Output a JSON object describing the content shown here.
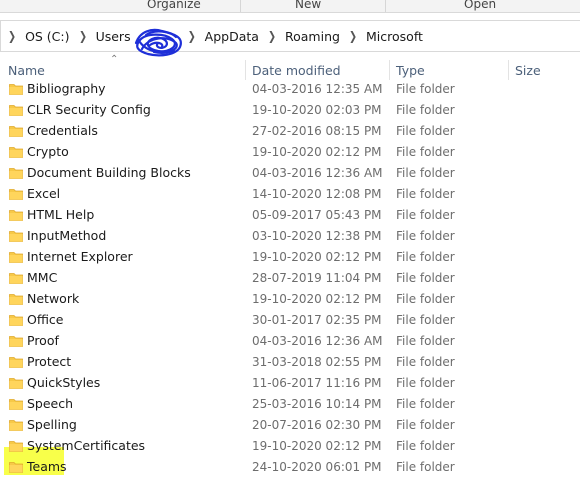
{
  "ribbon": {
    "groups": [
      "Organize",
      "New",
      "Open"
    ]
  },
  "address_bar": {
    "crumbs": [
      "OS (C:)",
      "Users",
      "AppData",
      "Roaming",
      "Microsoft"
    ]
  },
  "columns": {
    "name": "Name",
    "date_modified": "Date modified",
    "type": "Type",
    "size": "Size"
  },
  "colors": {
    "folder": "#f7c948",
    "highlight": "#f7ff2a",
    "scribble": "#1e2fd8"
  },
  "files": [
    {
      "name": "Bibliography",
      "date": "04-03-2016 12:35 AM",
      "type": "File folder"
    },
    {
      "name": "CLR Security Config",
      "date": "19-10-2020 02:03 PM",
      "type": "File folder"
    },
    {
      "name": "Credentials",
      "date": "27-02-2016 08:15 PM",
      "type": "File folder"
    },
    {
      "name": "Crypto",
      "date": "19-10-2020 02:12 PM",
      "type": "File folder"
    },
    {
      "name": "Document Building Blocks",
      "date": "04-03-2016 12:36 AM",
      "type": "File folder"
    },
    {
      "name": "Excel",
      "date": "14-10-2020 12:08 PM",
      "type": "File folder"
    },
    {
      "name": "HTML Help",
      "date": "05-09-2017 05:43 PM",
      "type": "File folder"
    },
    {
      "name": "InputMethod",
      "date": "03-10-2020 12:38 PM",
      "type": "File folder"
    },
    {
      "name": "Internet Explorer",
      "date": "19-10-2020 02:12 PM",
      "type": "File folder"
    },
    {
      "name": "MMC",
      "date": "28-07-2019 11:04 PM",
      "type": "File folder"
    },
    {
      "name": "Network",
      "date": "19-10-2020 02:12 PM",
      "type": "File folder"
    },
    {
      "name": "Office",
      "date": "30-01-2017 02:35 PM",
      "type": "File folder"
    },
    {
      "name": "Proof",
      "date": "04-03-2016 12:36 AM",
      "type": "File folder"
    },
    {
      "name": "Protect",
      "date": "31-03-2018 02:55 PM",
      "type": "File folder"
    },
    {
      "name": "QuickStyles",
      "date": "11-06-2017 11:16 PM",
      "type": "File folder"
    },
    {
      "name": "Speech",
      "date": "25-03-2016 10:14 PM",
      "type": "File folder"
    },
    {
      "name": "Spelling",
      "date": "20-07-2016 02:30 PM",
      "type": "File folder"
    },
    {
      "name": "SystemCertificates",
      "date": "19-10-2020 02:12 PM",
      "type": "File folder"
    },
    {
      "name": "Teams",
      "date": "24-10-2020 06:01 PM",
      "type": "File folder"
    }
  ]
}
